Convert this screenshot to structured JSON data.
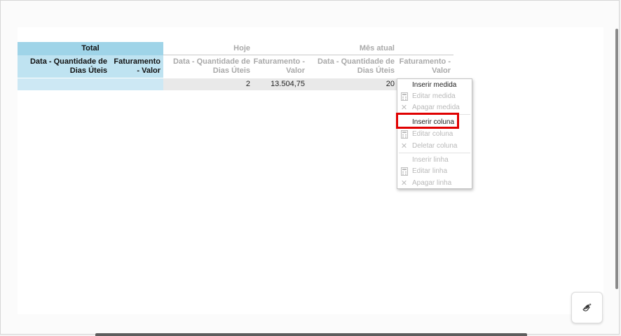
{
  "matrix": {
    "total_header": "Total",
    "total_col1": "Data - Quantidade de Dias Úteis",
    "total_col2": "Faturamento - Valor",
    "groups": [
      {
        "label": "Hoje",
        "col1": "Data - Quantidade de Dias Úteis",
        "col2": "Faturamento - Valor",
        "val1": "2",
        "val2": "13.504,75"
      },
      {
        "label": "Mês atual",
        "col1": "Data - Quantidade de Dias Úteis",
        "col2": "Faturamento - Valor",
        "val1": "20",
        "val2": ""
      }
    ]
  },
  "context_menu": {
    "items": [
      {
        "label": "Inserir medida",
        "enabled": true
      },
      {
        "label": "Editar medida",
        "enabled": false,
        "icon": "calculator-icon"
      },
      {
        "label": "Apagar medida",
        "enabled": false,
        "icon": "x-icon"
      },
      {
        "label": "Inserir coluna",
        "enabled": true,
        "highlighted": true
      },
      {
        "label": "Editar coluna",
        "enabled": false,
        "icon": "calculator-icon"
      },
      {
        "label": "Deletar coluna",
        "enabled": false,
        "icon": "x-icon"
      },
      {
        "label": "Inserir linha",
        "enabled": false
      },
      {
        "label": "Editar linha",
        "enabled": false,
        "icon": "calculator-icon"
      },
      {
        "label": "Apagar linha",
        "enabled": false,
        "icon": "x-icon"
      }
    ]
  },
  "colors": {
    "header_blue": "#9fd4e8",
    "row_blue": "#cde8f4",
    "highlight_red": "#e00000"
  },
  "fab": {
    "icon": "hand-sparkle-icon"
  }
}
